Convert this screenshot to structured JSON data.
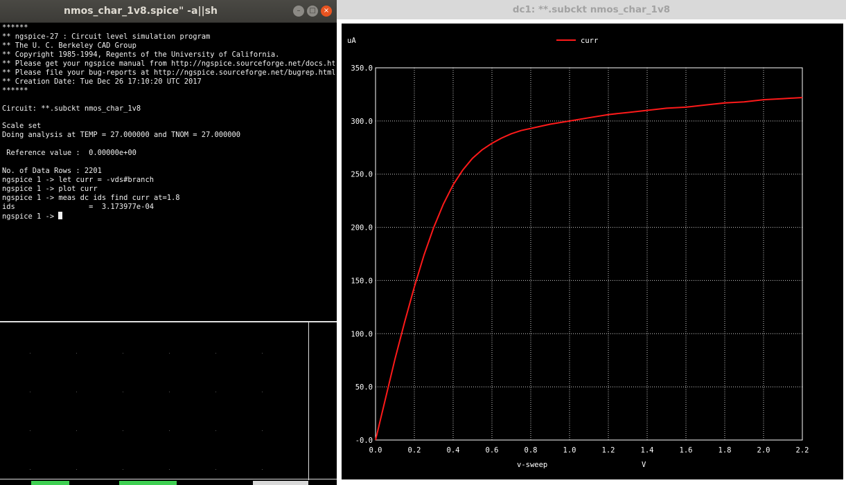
{
  "terminal": {
    "title": "nmos_char_1v8.spice\" -a||sh",
    "controls": {
      "minimize": "–",
      "maximize": "□",
      "close": "×"
    },
    "lines": [
      "******",
      "** ngspice-27 : Circuit level simulation program",
      "** The U. C. Berkeley CAD Group",
      "** Copyright 1985-1994, Regents of the University of California.",
      "** Please get your ngspice manual from http://ngspice.sourceforge.net/docs.html",
      "** Please file your bug-reports at http://ngspice.sourceforge.net/bugrep.html",
      "** Creation Date: Tue Dec 26 17:10:20 UTC 2017",
      "******",
      "",
      "Circuit: **.subckt nmos_char_1v8",
      "",
      "Scale set",
      "Doing analysis at TEMP = 27.000000 and TNOM = 27.000000",
      "",
      " Reference value :  0.00000e+00",
      "",
      "No. of Data Rows : 2201",
      "ngspice 1 -> let curr = -vds#branch",
      "ngspice 1 -> plot curr",
      "ngspice 1 -> meas dc ids find curr at=1.8",
      "ids                 =  3.173977e-04"
    ],
    "prompt": "ngspice 1 -> "
  },
  "plot_window": {
    "title": "dc1: **.subckt nmos_char_1v8"
  },
  "chart_data": {
    "type": "line",
    "ylabel": "uA",
    "xlabel": "v-sweep",
    "xunit": "V",
    "xlim": [
      0.0,
      2.2
    ],
    "ylim": [
      -0.0,
      350.0
    ],
    "x_ticks": [
      "0.0",
      "0.2",
      "0.4",
      "0.6",
      "0.8",
      "1.0",
      "1.2",
      "1.4",
      "1.6",
      "1.8",
      "2.0",
      "2.2"
    ],
    "y_ticks": [
      "-0.0",
      "50.0",
      "100.0",
      "150.0",
      "200.0",
      "250.0",
      "300.0",
      "350.0"
    ],
    "grid": true,
    "legend_position": "top-center",
    "background": "#000000",
    "axis_color": "#ffffff",
    "series": [
      {
        "name": "curr",
        "color": "#ff1a1a",
        "x": [
          0.0,
          0.05,
          0.1,
          0.15,
          0.2,
          0.25,
          0.3,
          0.35,
          0.4,
          0.45,
          0.5,
          0.55,
          0.6,
          0.65,
          0.7,
          0.75,
          0.8,
          0.9,
          1.0,
          1.1,
          1.2,
          1.3,
          1.4,
          1.5,
          1.6,
          1.7,
          1.8,
          1.9,
          2.0,
          2.1,
          2.2
        ],
        "values": [
          0,
          38,
          76,
          111,
          144,
          174,
          200,
          222,
          240,
          254,
          265,
          273,
          279,
          284,
          288,
          291,
          293,
          297,
          300,
          303,
          306,
          308,
          310,
          312,
          313,
          315,
          317,
          318,
          320,
          321,
          322
        ]
      }
    ]
  }
}
